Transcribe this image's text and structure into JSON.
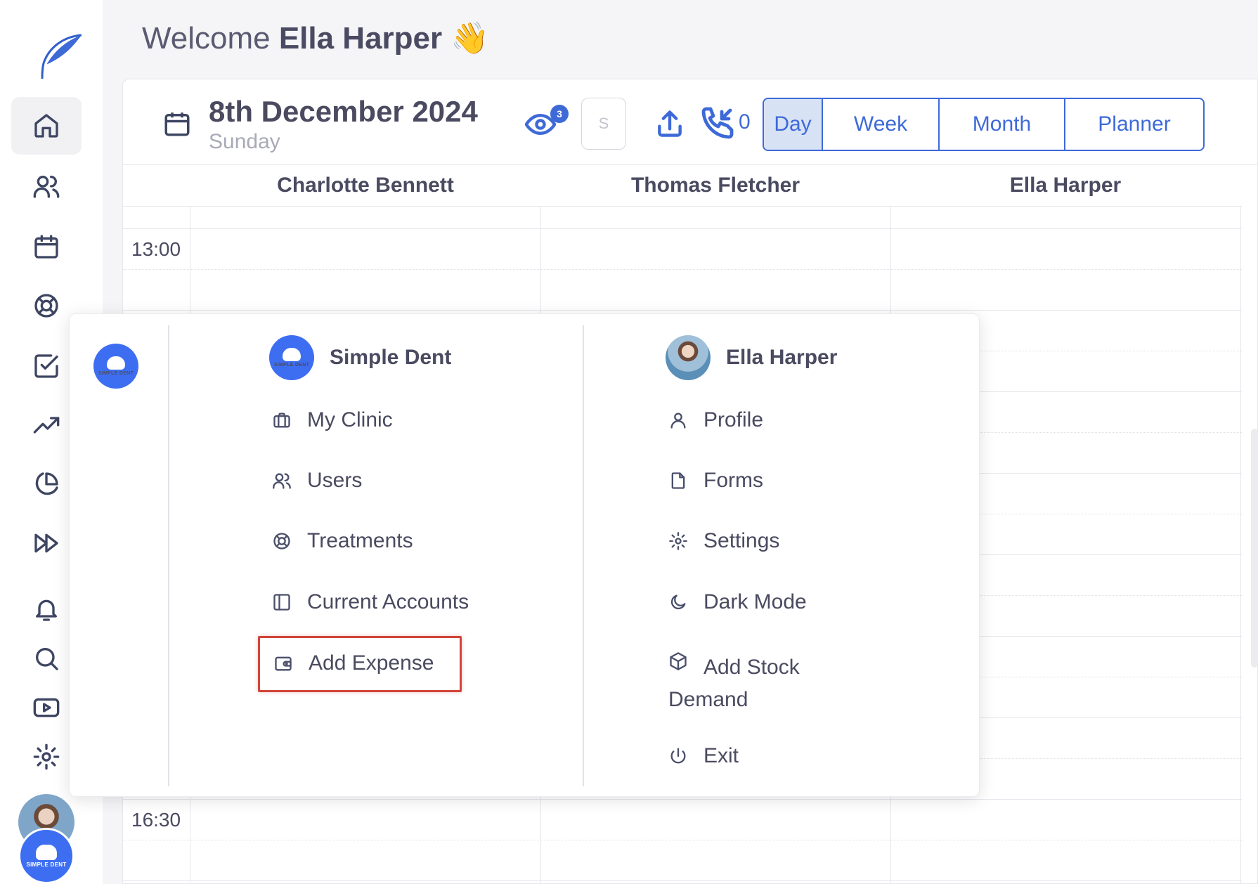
{
  "header": {
    "welcome_prefix": "Welcome",
    "user_name": "Ella Harper",
    "wave": "👋"
  },
  "date": {
    "main": "8th December 2024",
    "weekday": "Sunday"
  },
  "toolbar": {
    "viewers_count": "3",
    "search_placeholder": "S",
    "calls_count": "0"
  },
  "views": {
    "day": "Day",
    "week": "Week",
    "month": "Month",
    "planner": "Planner",
    "active": "Day"
  },
  "columns": [
    "Charlotte Bennett",
    "Thomas Fletcher",
    "Ella Harper"
  ],
  "times": {
    "t1": "13:00",
    "t2": "16:30"
  },
  "brand": {
    "clinic_mini": "SIMPLE DENT",
    "accent": "#3e6ad8",
    "clinic_color": "#3d6ef2",
    "highlight": "#d0463a"
  },
  "menu": {
    "clinic": {
      "title": "Simple Dent",
      "items": [
        "My Clinic",
        "Users",
        "Treatments",
        "Current Accounts",
        "Add Expense"
      ]
    },
    "user": {
      "title": "Ella Harper",
      "items": [
        "Profile",
        "Forms",
        "Settings",
        "Dark Mode",
        "Add Stock Demand",
        "Exit"
      ]
    }
  },
  "icons": {
    "sidebar": [
      "home-icon",
      "users-icon",
      "calendar-icon",
      "lifebuoy-icon",
      "checkbox-icon",
      "trending-icon",
      "pie-chart-icon",
      "fast-forward-icon",
      "bell-icon",
      "search-icon",
      "video-icon",
      "gear-icon"
    ]
  }
}
